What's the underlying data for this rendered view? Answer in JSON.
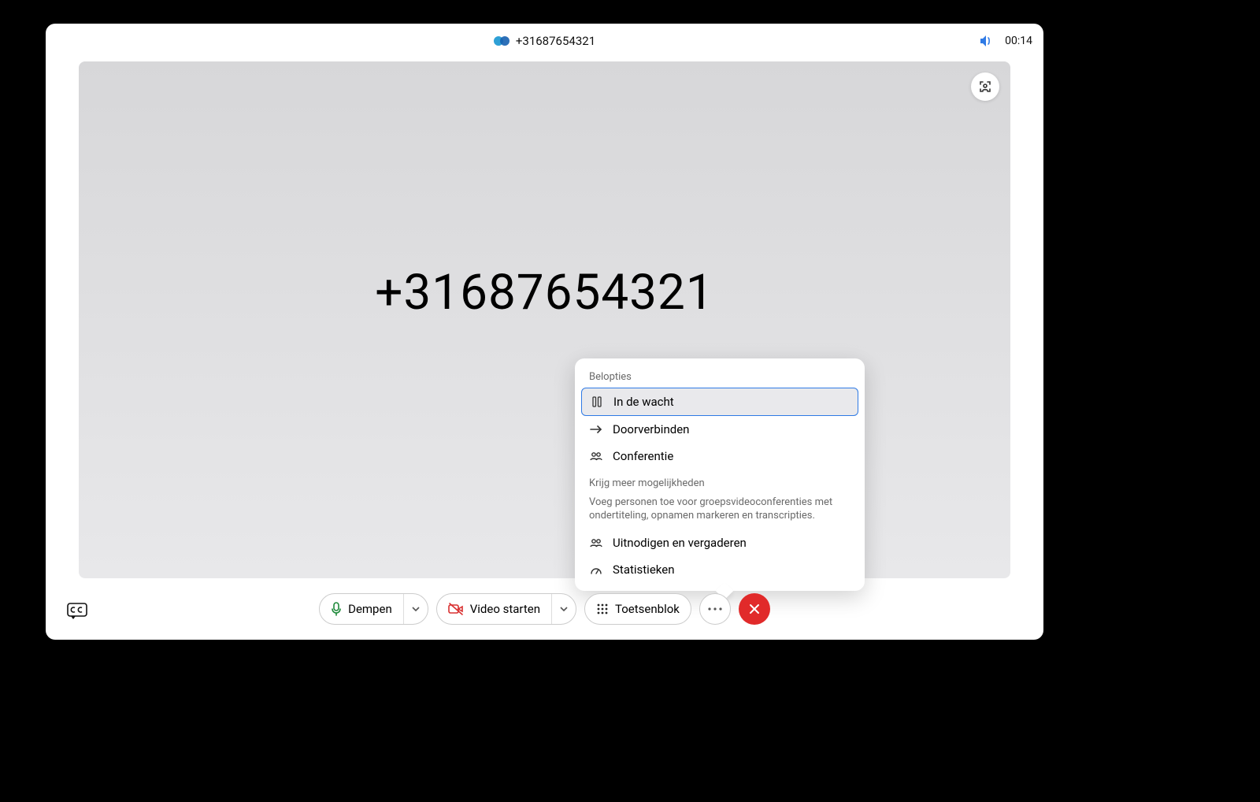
{
  "header": {
    "title": "+31687654321",
    "timer": "00:14"
  },
  "main": {
    "caller_display": "+31687654321"
  },
  "toolbar": {
    "mute_label": "Dempen",
    "video_label": "Video starten",
    "keypad_label": "Toetsenblok"
  },
  "popover": {
    "section1_label": "Belopties",
    "hold_label": "In de wacht",
    "transfer_label": "Doorverbinden",
    "conference_label": "Conferentie",
    "section2_label": "Krijg meer mogelijkheden",
    "section2_desc": "Voeg personen toe voor groepsvideoconferenties met ondertiteling, opnamen markeren en transcripties.",
    "invite_label": "Uitnodigen en vergaderen",
    "stats_label": "Statistieken"
  },
  "colors": {
    "end_call": "#e12a2a",
    "accent_blue": "#2f7ae5",
    "mic_green": "#1f8a3b",
    "video_red": "#d93030"
  }
}
